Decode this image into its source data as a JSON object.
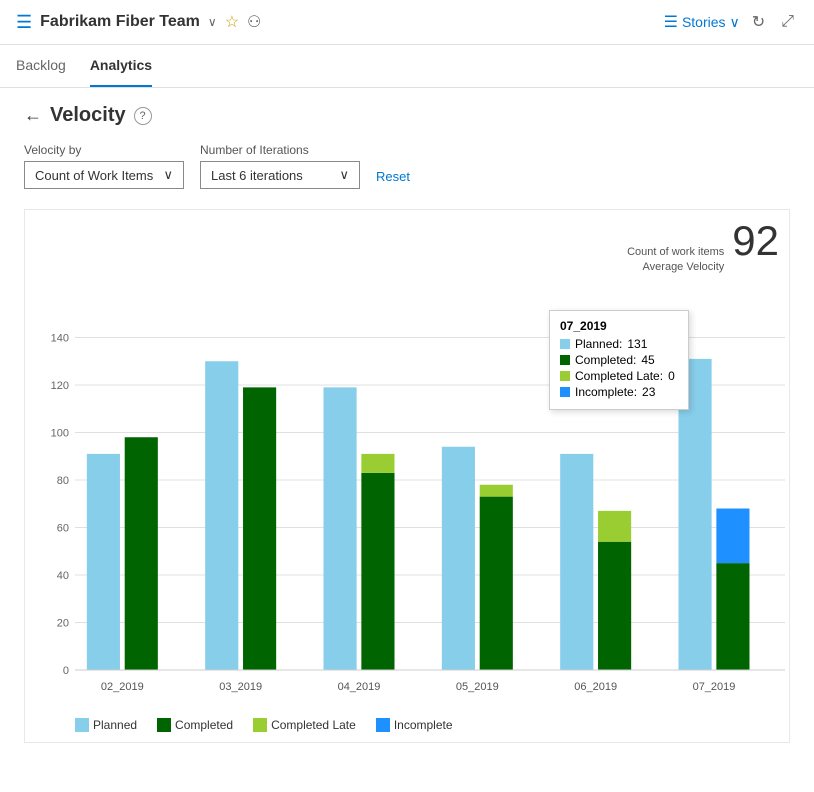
{
  "header": {
    "icon": "☰",
    "team_name": "Fabrikam Fiber Team",
    "chevron": "∨",
    "star": "☆",
    "people_icon": "⚇",
    "stories_label": "Stories",
    "stories_chevron": "∨",
    "refresh_icon": "↻",
    "expand_icon": "⤢"
  },
  "nav": {
    "tabs": [
      {
        "label": "Backlog",
        "active": false
      },
      {
        "label": "Analytics",
        "active": true
      }
    ]
  },
  "page": {
    "back_icon": "←",
    "title": "Velocity",
    "help_icon": "?"
  },
  "controls": {
    "velocity_by_label": "Velocity by",
    "velocity_by_value": "Count of Work Items",
    "iterations_label": "Number of Iterations",
    "iterations_value": "Last 6 iterations",
    "reset_label": "Reset"
  },
  "chart": {
    "count_label": "Count of work items",
    "avg_velocity_label": "Average Velocity",
    "avg_velocity_value": "92",
    "y_axis": [
      0,
      20,
      40,
      60,
      80,
      100,
      120,
      140
    ],
    "bars": [
      {
        "sprint": "02_2019",
        "planned": 91,
        "completed": 98,
        "completed_late": 0,
        "incomplete": 0
      },
      {
        "sprint": "03_2019",
        "planned": 130,
        "completed": 119,
        "completed_late": 0,
        "incomplete": 0
      },
      {
        "sprint": "04_2019",
        "planned": 119,
        "completed": 83,
        "completed_late": 8,
        "incomplete": 0
      },
      {
        "sprint": "05_2019",
        "planned": 94,
        "completed": 73,
        "completed_late": 5,
        "incomplete": 0
      },
      {
        "sprint": "06_2019",
        "planned": 91,
        "completed": 54,
        "completed_late": 13,
        "incomplete": 0
      },
      {
        "sprint": "07_2019",
        "planned": 131,
        "completed": 45,
        "completed_late": 0,
        "incomplete": 23
      }
    ],
    "tooltip": {
      "sprint": "07_2019",
      "planned_label": "Planned:",
      "planned_value": 131,
      "completed_label": "Completed:",
      "completed_value": 45,
      "completed_late_label": "Completed Late:",
      "completed_late_value": 0,
      "incomplete_label": "Incomplete:",
      "incomplete_value": 23
    },
    "legend": [
      {
        "label": "Planned",
        "color": "#add8e6"
      },
      {
        "label": "Completed",
        "color": "#006400"
      },
      {
        "label": "Completed Late",
        "color": "#90ee90"
      },
      {
        "label": "Incomplete",
        "color": "#1e90ff"
      }
    ],
    "colors": {
      "planned": "#87ceeb",
      "completed": "#006400",
      "completed_late": "#9acd32",
      "incomplete": "#1e90ff"
    }
  }
}
